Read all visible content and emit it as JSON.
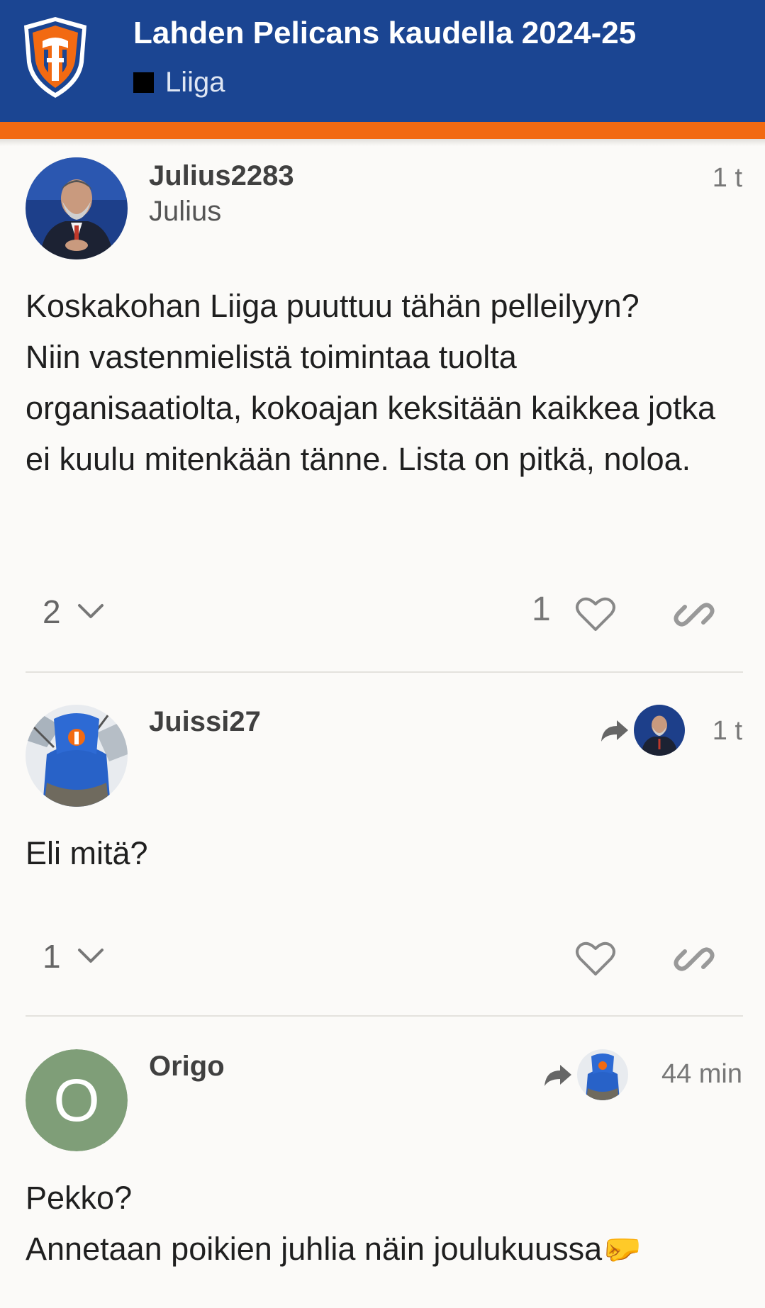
{
  "header": {
    "title": "Lahden Pelicans kaudella 2024-25",
    "category": "Liiga",
    "colors": {
      "bar": "#1b4592",
      "stripe": "#f26a12"
    }
  },
  "posts": [
    {
      "username": "Julius2283",
      "fullname": "Julius",
      "date": "1 t",
      "body": [
        "Koskakohan Liiga puuttuu tähän pelleilyyn?",
        "Niin vastenmielistä toimintaa tuolta organisaatiolta, kokoajan keksitään kaikkea jotka ei kuulu mitenkään tänne. Lista on pitkä, noloa."
      ],
      "replies": "2",
      "likes": "1"
    },
    {
      "username": "Juissi27",
      "date": "1 t",
      "body": [
        "Eli mitä?"
      ],
      "replies": "1",
      "likes": ""
    },
    {
      "username": "Origo",
      "avatar_letter": "O",
      "date": "44 min",
      "body": [
        "Pekko?",
        "Annetaan poikien juhlia näin joulukuussa🤛"
      ]
    }
  ]
}
